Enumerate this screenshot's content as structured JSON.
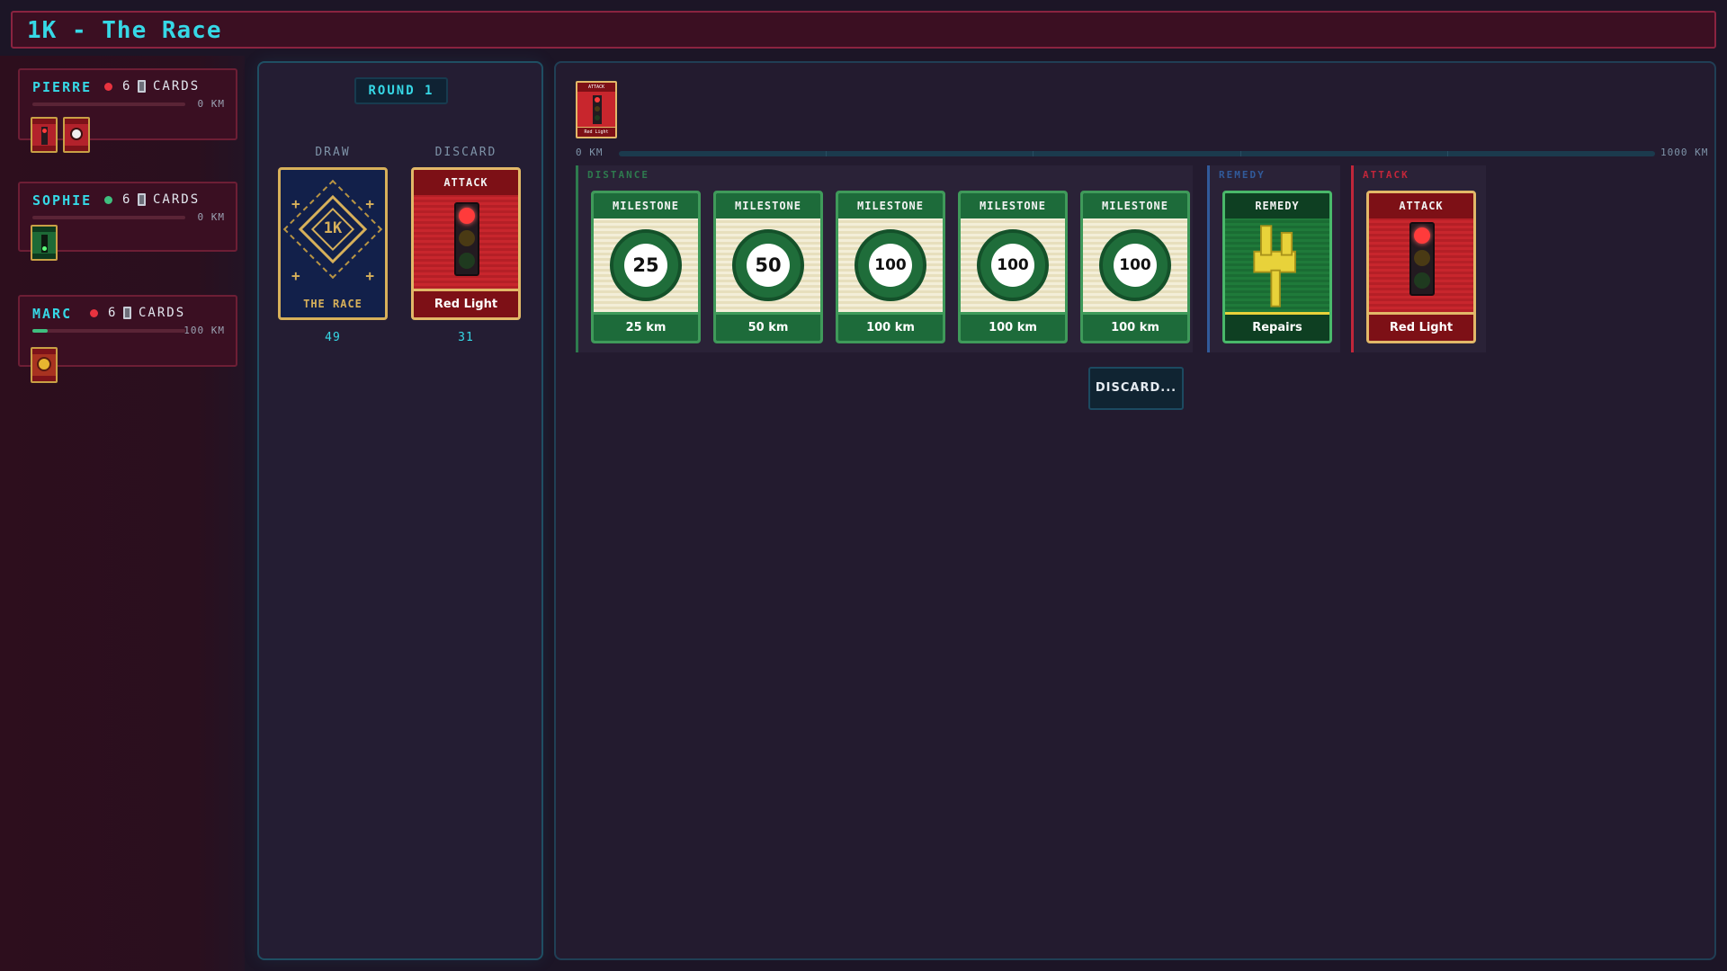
{
  "app": {
    "title": "1K - The Race"
  },
  "players": [
    {
      "name": "PIERRE",
      "status_color": "#e8333f",
      "card_count": "6",
      "cards_label": "CARDS",
      "km_label": "0 KM",
      "progress": 0,
      "battle_cards": [
        "Red Light",
        "Flat Tire"
      ]
    },
    {
      "name": "SOPHIE",
      "status_color": "#3fbf7f",
      "card_count": "6",
      "cards_label": "CARDS",
      "km_label": "0 KM",
      "progress": 0,
      "battle_cards": [
        "Green Light"
      ]
    },
    {
      "name": "MARC",
      "status_color": "#e8333f",
      "card_count": "6",
      "cards_label": "CARDS",
      "km_label": "100 KM",
      "progress": 0.1,
      "battle_cards": [
        "Accident"
      ]
    }
  ],
  "deck": {
    "round": "ROUND 1",
    "draw_label": "DRAW",
    "discard_label": "DISCARD",
    "draw_count": "49",
    "discard_count": "31",
    "back_logo": "1K",
    "back_name": "THE RACE",
    "discard_top": {
      "type": "ATTACK",
      "name": "Red Light"
    }
  },
  "board": {
    "battle_card": {
      "type": "ATTACK",
      "name": "Red Light"
    },
    "km_start": "0 KM",
    "km_end": "1000 KM",
    "progress": 0,
    "groups": {
      "distance": {
        "label": "DISTANCE",
        "color": "#2e7a4e"
      },
      "remedy": {
        "label": "REMEDY",
        "color": "#315a9a"
      },
      "attack": {
        "label": "ATTACK",
        "color": "#c2263a"
      }
    },
    "hand": [
      {
        "type": "MILESTONE",
        "value": "25",
        "name": "25 km"
      },
      {
        "type": "MILESTONE",
        "value": "50",
        "name": "50 km"
      },
      {
        "type": "MILESTONE",
        "value": "100",
        "name": "100 km"
      },
      {
        "type": "MILESTONE",
        "value": "100",
        "name": "100 km"
      },
      {
        "type": "MILESTONE",
        "value": "100",
        "name": "100 km"
      },
      {
        "type": "REMEDY",
        "name": "Repairs",
        "icon": "wrench-icon"
      },
      {
        "type": "ATTACK",
        "name": "Red Light",
        "icon": "traffic-light-icon"
      }
    ],
    "discard_button": "DISCARD..."
  },
  "colors": {
    "accent": "#36d8e6",
    "attack": "#c8262d",
    "milestone": "#1d6b3a",
    "remedy": "#1f7a3a",
    "gold": "#e2b868"
  }
}
